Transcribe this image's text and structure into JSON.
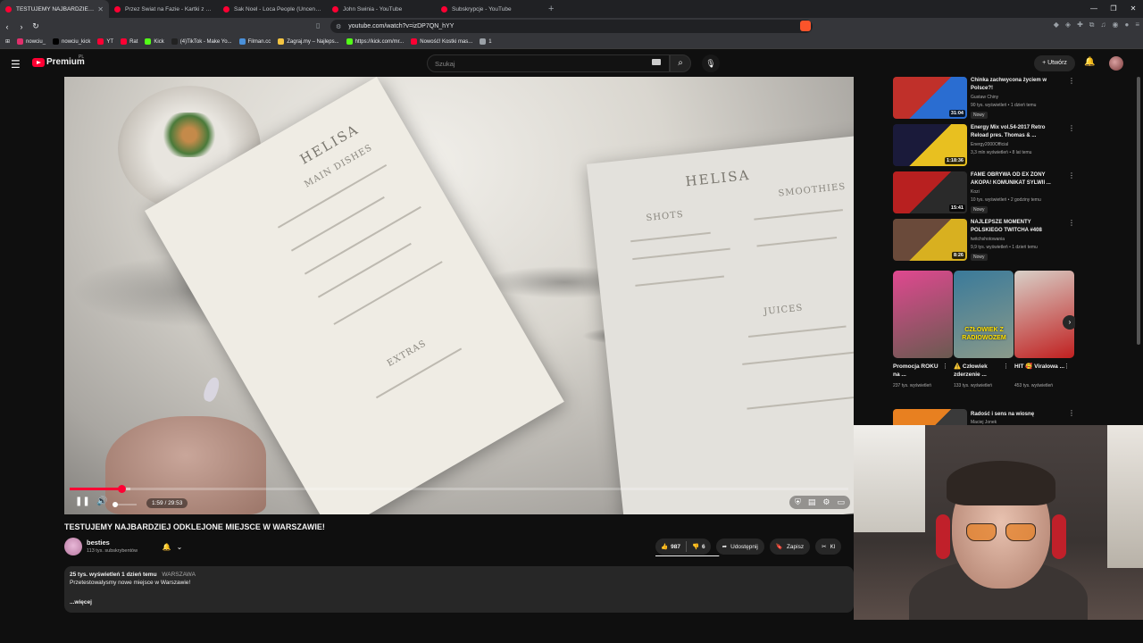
{
  "browser": {
    "tabs": [
      {
        "title": "TESTUJEMY NAJBARDZIEJ OD",
        "active": true
      },
      {
        "title": "Przez Świat na Fazie - Kartki z podróż",
        "active": false
      },
      {
        "title": "Sak Noel - Loca People (Uncensored",
        "active": false
      },
      {
        "title": "John Świnia - YouTube",
        "active": false
      },
      {
        "title": "Subskrypcje - YouTube",
        "active": false
      }
    ],
    "url": "youtube.com/watch?v=izDP7QN_hYY",
    "bookmarks": [
      {
        "label": "nowciu_",
        "color": "#e1306c"
      },
      {
        "label": "nowciu_kick",
        "color": "#000000"
      },
      {
        "label": "YT",
        "color": "#ff0033"
      },
      {
        "label": "Rat",
        "color": "#ff0033"
      },
      {
        "label": "Kick",
        "color": "#53fc18"
      },
      {
        "label": "(4)TikTok - Make Yo...",
        "color": "#222222"
      },
      {
        "label": "Filman.cc",
        "color": "#4a90d9"
      },
      {
        "label": "Zagraj.my – Najleps...",
        "color": "#f5c542"
      },
      {
        "label": "https://kick.com/mr...",
        "color": "#53fc18"
      },
      {
        "label": "Nowość! Kostki mas...",
        "color": "#ff0033"
      },
      {
        "label": "1",
        "color": "#9aa0a6"
      }
    ]
  },
  "header": {
    "logo_text": "Premium",
    "region": "PL",
    "search_placeholder": "Szukaj",
    "create_label": "Utwórz"
  },
  "player": {
    "time": "1:59 / 29:53",
    "progress": 0.066,
    "buffered": 0.078,
    "menu_left_title": "HELISA",
    "menu_left_sections": [
      "MAIN DISHES",
      "EXTRAS"
    ],
    "menu_right_title": "HELISA",
    "menu_right_sections": [
      "SHOTS",
      "SMOOTHIES",
      "JUICES"
    ]
  },
  "video": {
    "title": "TESTUJEMY NAJBARDZIEJ ODKLEJONE MIEJSCE W WARSZAWIE!",
    "channel": "besties",
    "subscribers": "113 tys. subskrybentów",
    "likes": "987",
    "dislikes": "6",
    "like_ratio": 0.99,
    "share_label": "Udostępnij",
    "save_label": "Zapisz",
    "clip_label": "Kl",
    "views_time": "25 tys. wyświetleń  1 dzień temu",
    "location_tag": "WARSZAWA",
    "description": "Przetestowalysmy nowe miejsce w Warszawie!",
    "more_label": "...więcej"
  },
  "sidebar": {
    "recommended": [
      {
        "title": "Chinka zachwycona życiem w Polsce?!",
        "channel": "Gustaw Chiny",
        "stats": "90 tys. wyświetleń • 1 dzień temu",
        "badge": "Nowy",
        "duration": "31:04",
        "colors": [
          "#c0302a",
          "#2a6dd1"
        ]
      },
      {
        "title": "Energy Mix vol.54-2017 Retro Reload pres. Thomas & ...",
        "channel": "Energy2000Official",
        "stats": "3,3 mln wyświetleń • 8 lat temu",
        "badge": "",
        "duration": "1:18:36",
        "colors": [
          "#1a1a3a",
          "#e8c020"
        ]
      },
      {
        "title": "FAME OBRYWA OD EX ŻONY AKOPA! KOMUNIKAT SYLWII ...",
        "channel": "Kozi",
        "stats": "10 tys. wyświetleń • 2 godziny temu",
        "badge": "Nowy",
        "duration": "15:41",
        "colors": [
          "#b82020",
          "#2a2a2a"
        ]
      },
      {
        "title": "NAJLEPSZE MOMENTY POLSKIEGO TWITCHA #408",
        "channel": "twitchshotowania",
        "stats": "9,9 tys. wyświetleń • 1 dzień temu",
        "badge": "Nowy",
        "duration": "8:26",
        "colors": [
          "#6a4a3a",
          "#d8b020"
        ]
      },
      {
        "title": "Radość i sens na wiosnę",
        "channel": "Maciej Jonek",
        "stats": "",
        "badge": "",
        "duration": "",
        "colors": [
          "#e88020",
          "#3a3a3a"
        ]
      }
    ],
    "shorts": [
      {
        "title": "Promocja ROKU na ...",
        "views": "237 tys. wyświetleń",
        "caption": "",
        "colors": [
          "#e04890",
          "#6a5a50"
        ]
      },
      {
        "title": "⚠️ Człowiek zderzenie ...",
        "views": "133 tys. wyświetleń",
        "caption": "CZŁOWIEK Z RADIOWOZEM",
        "colors": [
          "#3a7a9a",
          "#8a9a8a"
        ]
      },
      {
        "title": "HIT 🥰 Viralowa ...",
        "views": "453 tys. wyświetleń",
        "caption": "",
        "colors": [
          "#d8d0c8",
          "#c02020"
        ]
      }
    ]
  }
}
